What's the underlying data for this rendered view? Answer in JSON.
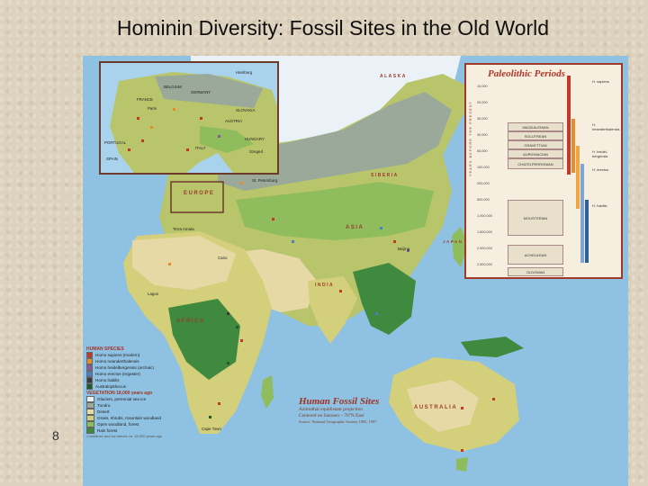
{
  "slide": {
    "title": "Hominin Diversity: Fossil Sites in the Old World",
    "page_number": "8"
  },
  "map": {
    "caption": {
      "title": "Human Fossil Sites",
      "subtitle_1": "Azimuthal equidistant projection",
      "subtitle_2": "Centered on Saussen – 70°N East",
      "source": "Source: National Geographic Society 1985, 1997"
    },
    "regions": {
      "europe": "EUROPE",
      "asia": "ASIA",
      "africa": "AFRICA",
      "australia": "AUSTRALIA",
      "alaska": "ALASKA",
      "siberia": "SIBERIA",
      "india": "INDIA",
      "japan": "JAPAN"
    },
    "site_labels": {
      "st_petersburg": "St. Petersburg",
      "beijing": "Beijing",
      "cape_town": "Cape Town",
      "terra_amata": "Terra Amata",
      "lagos": "Lagos",
      "cairo": "Cairo"
    },
    "inset": {
      "labels": {
        "hamburg": "Hamburg",
        "germany": "GERMANY",
        "france": "FRANCE",
        "paris": "Paris",
        "italy": "ITALY",
        "austria": "AUSTRIA",
        "hungary": "HUNGARY",
        "szeged": "Szeged",
        "spain": "SPAIN",
        "slovakia": "SLOVAKIA",
        "belgium": "BELGIUM",
        "portugal": "PORTUGAL"
      }
    },
    "legend": {
      "species_heading": "HUMAN SPECIES",
      "species": [
        {
          "label": "Homo sapiens (modern)",
          "color": "#c2382b"
        },
        {
          "label": "Homo neanderthalensis",
          "color": "#e98b2a"
        },
        {
          "label": "Homo heidelbergensis (archaic)",
          "color": "#8a5a9a"
        },
        {
          "label": "Homo erectus (ergaster)",
          "color": "#4a7fc0"
        },
        {
          "label": "Homo habilis",
          "color": "#3a3a3a"
        },
        {
          "label": "Australopithecus",
          "color": "#1f5c2a"
        }
      ],
      "vegetation_heading": "VEGETATION 18,000 years ago",
      "vegetation": [
        {
          "label": "Glaciers, perennial sea ice",
          "color": "#e7eef5"
        },
        {
          "label": "Tundra",
          "color": "#9aa99a"
        },
        {
          "label": "Desert",
          "color": "#e7d9a6"
        },
        {
          "label": "Grass, shrubs, mountain woodland",
          "color": "#d3cf7a"
        },
        {
          "label": "Open woodland, forest",
          "color": "#8fbc5c"
        },
        {
          "label": "Rain forest",
          "color": "#3f8a3f"
        }
      ],
      "note": "Coastlines and ice sheets ca. 18,000 years ago"
    },
    "paleolithic": {
      "title": "Paleolithic Periods",
      "axis_title": "YEARS BEFORE THE PRESENT",
      "ticks": [
        "10,000",
        "20,000",
        "30,000",
        "40,000",
        "50,000",
        "100,000",
        "200,000",
        "500,000",
        "1,000,000",
        "1,500,000",
        "2,000,000",
        "2,500,000"
      ],
      "periods": [
        {
          "label": "MAGDALENIAN",
          "color": "#e9e0cc"
        },
        {
          "label": "SOLUTREAN",
          "color": "#e9e0cc"
        },
        {
          "label": "GRAVETTIAN",
          "color": "#e9e0cc"
        },
        {
          "label": "AURIGNACIAN",
          "color": "#e9e0cc"
        },
        {
          "label": "CHATELPERRONIAN",
          "color": "#e9e0cc"
        },
        {
          "label": "MOUSTERIAN",
          "color": "#e9e0cc"
        },
        {
          "label": "ACHEULEAN",
          "color": "#e9e0cc"
        },
        {
          "label": "OLDOWAN",
          "color": "#e9e0cc"
        }
      ],
      "species_bars": [
        {
          "label": "H. sapiens",
          "color": "#c2382b"
        },
        {
          "label": "H. neanderthalensis",
          "color": "#e98b2a"
        },
        {
          "label": "H. heidel-bergensis",
          "color": "#f0a540"
        },
        {
          "label": "H. erectus",
          "color": "#7fa6d8"
        },
        {
          "label": "H. habilis",
          "color": "#2f5f9a"
        }
      ]
    }
  }
}
